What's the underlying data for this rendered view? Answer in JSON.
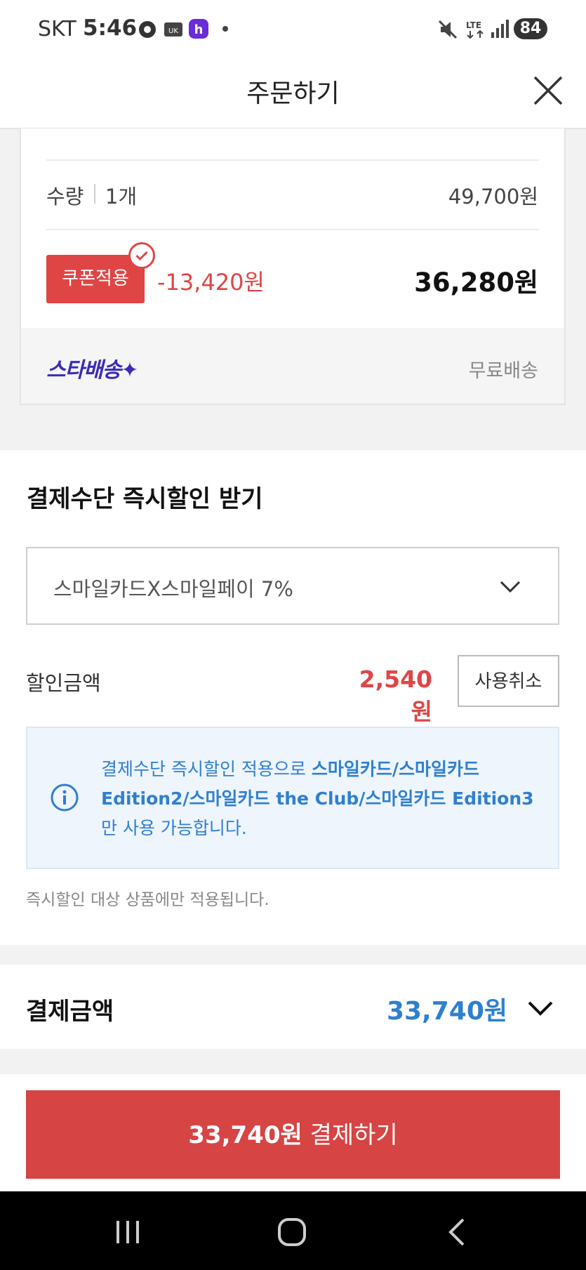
{
  "status_bar": {
    "carrier": "SKT",
    "time": "5:46",
    "battery": "84"
  },
  "header": {
    "title": "주문하기"
  },
  "order_item": {
    "quantity_label": "수량",
    "quantity_value": "1개",
    "original_price": "49,700원",
    "coupon_label": "쿠폰적용",
    "coupon_discount": "-13,420원",
    "final_price": "36,280원",
    "delivery_logo": "스타배송✦",
    "delivery_status": "무료배송"
  },
  "instant_discount": {
    "title": "결제수단 즉시할인 받기",
    "selected_option": "스마일카드X스마일페이 7%",
    "discount_label": "할인금액",
    "discount_amount": "2,540원",
    "cancel_label": "사용취소",
    "info_prefix": "결제수단 즉시할인 적용으로 ",
    "info_cards": "스마일카드/스마일카드 Edition2/스마일카드 the Club/스마일카드 Edition3",
    "info_suffix": "만 사용 가능합니다.",
    "note": "즉시할인 대상 상품에만 적용됩니다."
  },
  "payment_total": {
    "label": "결제금액",
    "amount": "33,740원"
  },
  "pay_button": {
    "amount": "33,740원",
    "action": " 결제하기"
  },
  "colors": {
    "accent_red": "#e04545",
    "accent_blue": "#2f7fd0",
    "star_delivery": "#3b2bb8"
  }
}
